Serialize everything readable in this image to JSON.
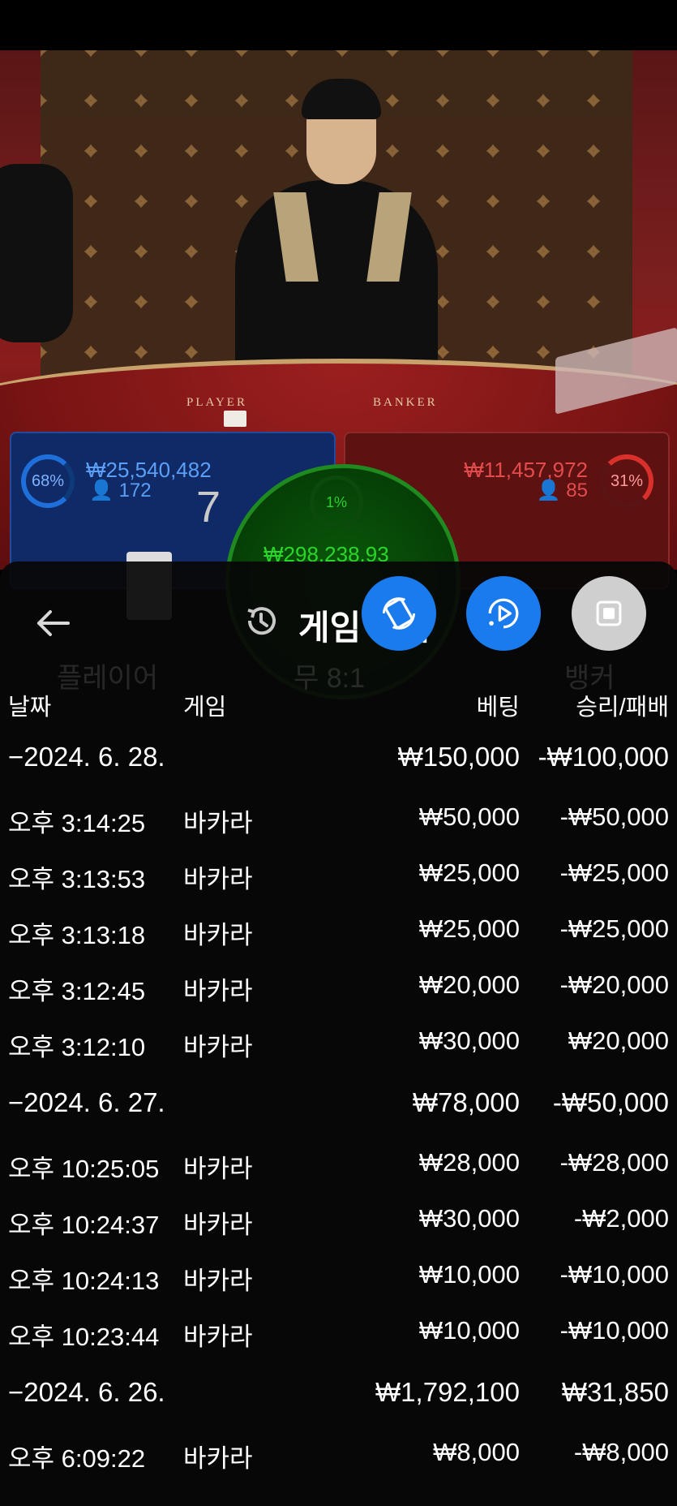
{
  "video": {
    "felt_player_label": "PLAYER",
    "felt_banker_label": "BANKER"
  },
  "bet_stats": {
    "player": {
      "percent": "68%",
      "amount": "₩25,540,482",
      "players": "172",
      "score": "7"
    },
    "banker": {
      "percent": "31%",
      "amount": "₩11,457,972",
      "players": "85"
    },
    "tie": {
      "percent": "1%",
      "amount": "₩298,238.93"
    }
  },
  "background_ghost_text": {
    "player": "플레이어",
    "tie": "무 8:1",
    "banker": "뱅커"
  },
  "header": {
    "title_visible": "게임",
    "title_suffix": "내",
    "fab_icons": [
      "rotate-cycle-icon",
      "replay-video-icon",
      "stop-square-icon"
    ]
  },
  "table": {
    "columns": {
      "date": "날짜",
      "game": "게임",
      "bet": "베팅",
      "result": "승리/패배"
    },
    "rows": [
      {
        "type": "group",
        "date": "−2024. 6. 28.",
        "bet": "₩150,000",
        "result": "-₩100,000"
      },
      {
        "type": "item",
        "date": "오후 3:14:25",
        "game": "바카라",
        "bet": "₩50,000",
        "result": "-₩50,000"
      },
      {
        "type": "item",
        "date": "오후 3:13:53",
        "game": "바카라",
        "bet": "₩25,000",
        "result": "-₩25,000"
      },
      {
        "type": "item",
        "date": "오후 3:13:18",
        "game": "바카라",
        "bet": "₩25,000",
        "result": "-₩25,000"
      },
      {
        "type": "item",
        "date": "오후 3:12:45",
        "game": "바카라",
        "bet": "₩20,000",
        "result": "-₩20,000"
      },
      {
        "type": "item",
        "date": "오후 3:12:10",
        "game": "바카라",
        "bet": "₩30,000",
        "result": "₩20,000"
      },
      {
        "type": "group",
        "date": "−2024. 6. 27.",
        "bet": "₩78,000",
        "result": "-₩50,000"
      },
      {
        "type": "item",
        "date": "오후 10:25:05",
        "game": "바카라",
        "bet": "₩28,000",
        "result": "-₩28,000"
      },
      {
        "type": "item",
        "date": "오후 10:24:37",
        "game": "바카라",
        "bet": "₩30,000",
        "result": "-₩2,000"
      },
      {
        "type": "item",
        "date": "오후 10:24:13",
        "game": "바카라",
        "bet": "₩10,000",
        "result": "-₩10,000"
      },
      {
        "type": "item",
        "date": "오후 10:23:44",
        "game": "바카라",
        "bet": "₩10,000",
        "result": "-₩10,000"
      },
      {
        "type": "group",
        "date": "−2024. 6. 26.",
        "bet": "₩1,792,100",
        "result": "₩31,850"
      },
      {
        "type": "item",
        "date": "오후 6:09:22",
        "game": "바카라",
        "bet": "₩8,000",
        "result": "-₩8,000"
      }
    ]
  }
}
